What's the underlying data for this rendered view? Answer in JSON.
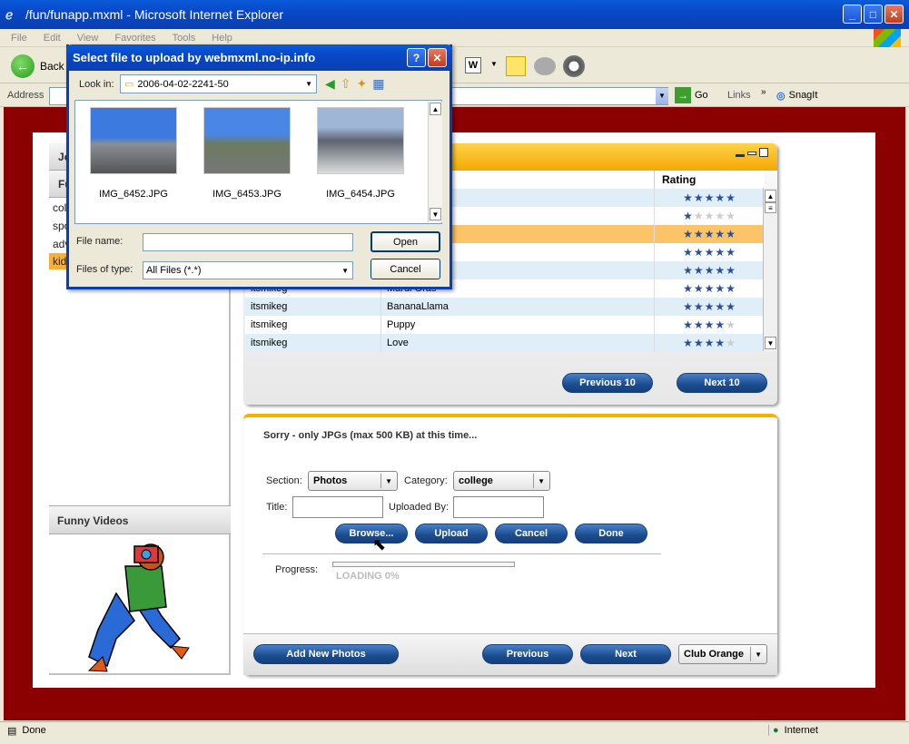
{
  "window": {
    "title": "/fun/funapp.mxml - Microsoft Internet Explorer"
  },
  "menu": [
    "File",
    "Edit",
    "View",
    "Favorites",
    "Tools",
    "Help"
  ],
  "toolbar": {
    "back_label": "Back"
  },
  "address": {
    "label": "Address",
    "go_label": "Go",
    "links_label": "Links",
    "snagit_label": "SnagIt"
  },
  "left_panel": {
    "tabs": [
      "Jo",
      "Fu"
    ],
    "items": [
      "col",
      "spo",
      "adv",
      "kid"
    ],
    "selected_index": 3,
    "funny_videos": "Funny Videos"
  },
  "grid": {
    "rating_header": "Rating",
    "rows": [
      {
        "user": "",
        "title": "",
        "rating": 5
      },
      {
        "user": "",
        "title": "",
        "rating": 1
      },
      {
        "user": "",
        "title": "",
        "rating": 5,
        "selected": true
      },
      {
        "user": "",
        "title": "",
        "rating": 5
      },
      {
        "user": "",
        "title": "",
        "rating": 5
      },
      {
        "user": "itsmikeg",
        "title": "Mardi Gras",
        "rating": 5
      },
      {
        "user": "itsmikeg",
        "title": "BananaLlama",
        "rating": 5
      },
      {
        "user": "itsmikeg",
        "title": "Puppy",
        "rating": 4
      },
      {
        "user": "itsmikeg",
        "title": "Love",
        "rating": 4
      }
    ],
    "prev_label": "Previous 10",
    "next_label": "Next 10"
  },
  "upload": {
    "notice": "Sorry - only JPGs (max 500 KB) at this time...",
    "section_label": "Section:",
    "section_value": "Photos",
    "category_label": "Category:",
    "category_value": "college",
    "title_label": "Title:",
    "uploaded_by_label": "Uploaded By:",
    "browse_label": "Browse...",
    "upload_label": "Upload",
    "cancel_label": "Cancel",
    "done_label": "Done",
    "progress_label": "Progress:",
    "progress_text": "LOADING 0%",
    "progress_value": 0.0
  },
  "bottom": {
    "add_label": "Add New Photos",
    "previous_label": "Previous",
    "next_label": "Next",
    "theme_value": "Club Orange"
  },
  "dialog": {
    "title": "Select file to upload by webmxml.no-ip.info",
    "look_in_label": "Look in:",
    "look_in_value": "2006-04-02-2241-50",
    "files": [
      "IMG_6452.JPG",
      "IMG_6453.JPG",
      "IMG_6454.JPG"
    ],
    "file_name_label": "File name:",
    "file_name_value": "",
    "file_type_label": "Files of type:",
    "file_type_value": "All Files (*.*)",
    "open_label": "Open",
    "cancel_label": "Cancel"
  },
  "status": {
    "left": "Done",
    "zone": "Internet"
  },
  "colors": {
    "accent_orange": "#f3b100",
    "frame_red": "#8b0000",
    "button_blue": "#1a4c90"
  }
}
